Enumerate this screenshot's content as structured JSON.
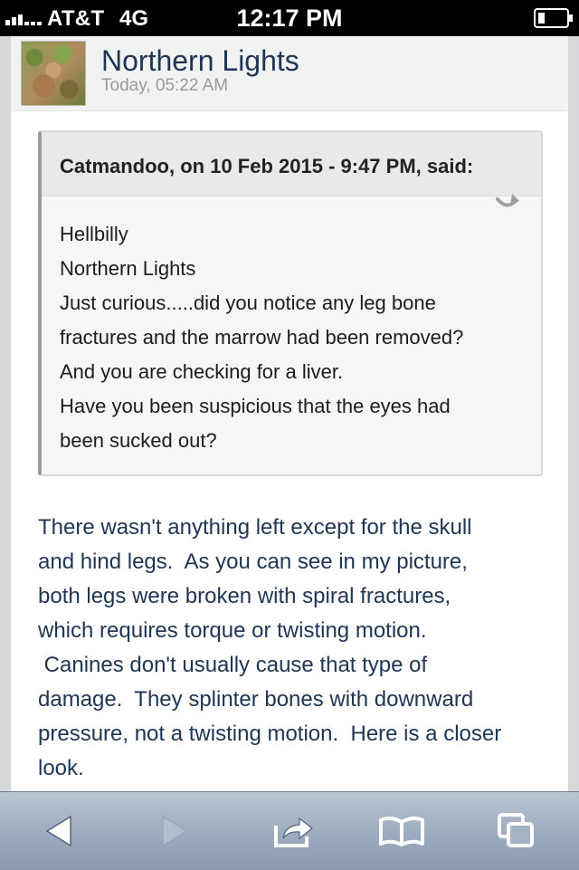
{
  "status_bar": {
    "carrier": "AT&T",
    "network": "4G",
    "time": "12:17 PM"
  },
  "post": {
    "author": "Northern Lights",
    "date": "Today, 05:22 AM",
    "quote": {
      "citation": "Catmandoo, on 10 Feb 2015 - 9:47 PM, said:",
      "lines": [
        "Hellbilly",
        "Northern Lights",
        "Just curious.....did you notice any leg bone",
        "fractures and the marrow had been removed?",
        "And you are checking for a liver.",
        "Have you been suspicious that the eyes had",
        "been sucked out?"
      ]
    },
    "body_lines": [
      "There wasn't anything left except for the skull",
      "and hind legs.  As you can see in my picture,",
      "both legs were broken with spiral fractures,",
      "which requires torque or twisting motion.",
      " Canines don't usually cause that type of",
      "damage.  They splinter bones with downward",
      "pressure, not a twisting motion.  Here is a closer",
      "look."
    ]
  },
  "toolbar": {
    "icons": [
      "back-arrow-icon",
      "forward-arrow-icon",
      "share-icon",
      "bookmarks-icon",
      "tabs-icon"
    ]
  },
  "colors": {
    "author_text": "#1f3554",
    "body_text": "#1f3554",
    "toolbar": "#9fadc1",
    "status_bar": "#000000"
  }
}
